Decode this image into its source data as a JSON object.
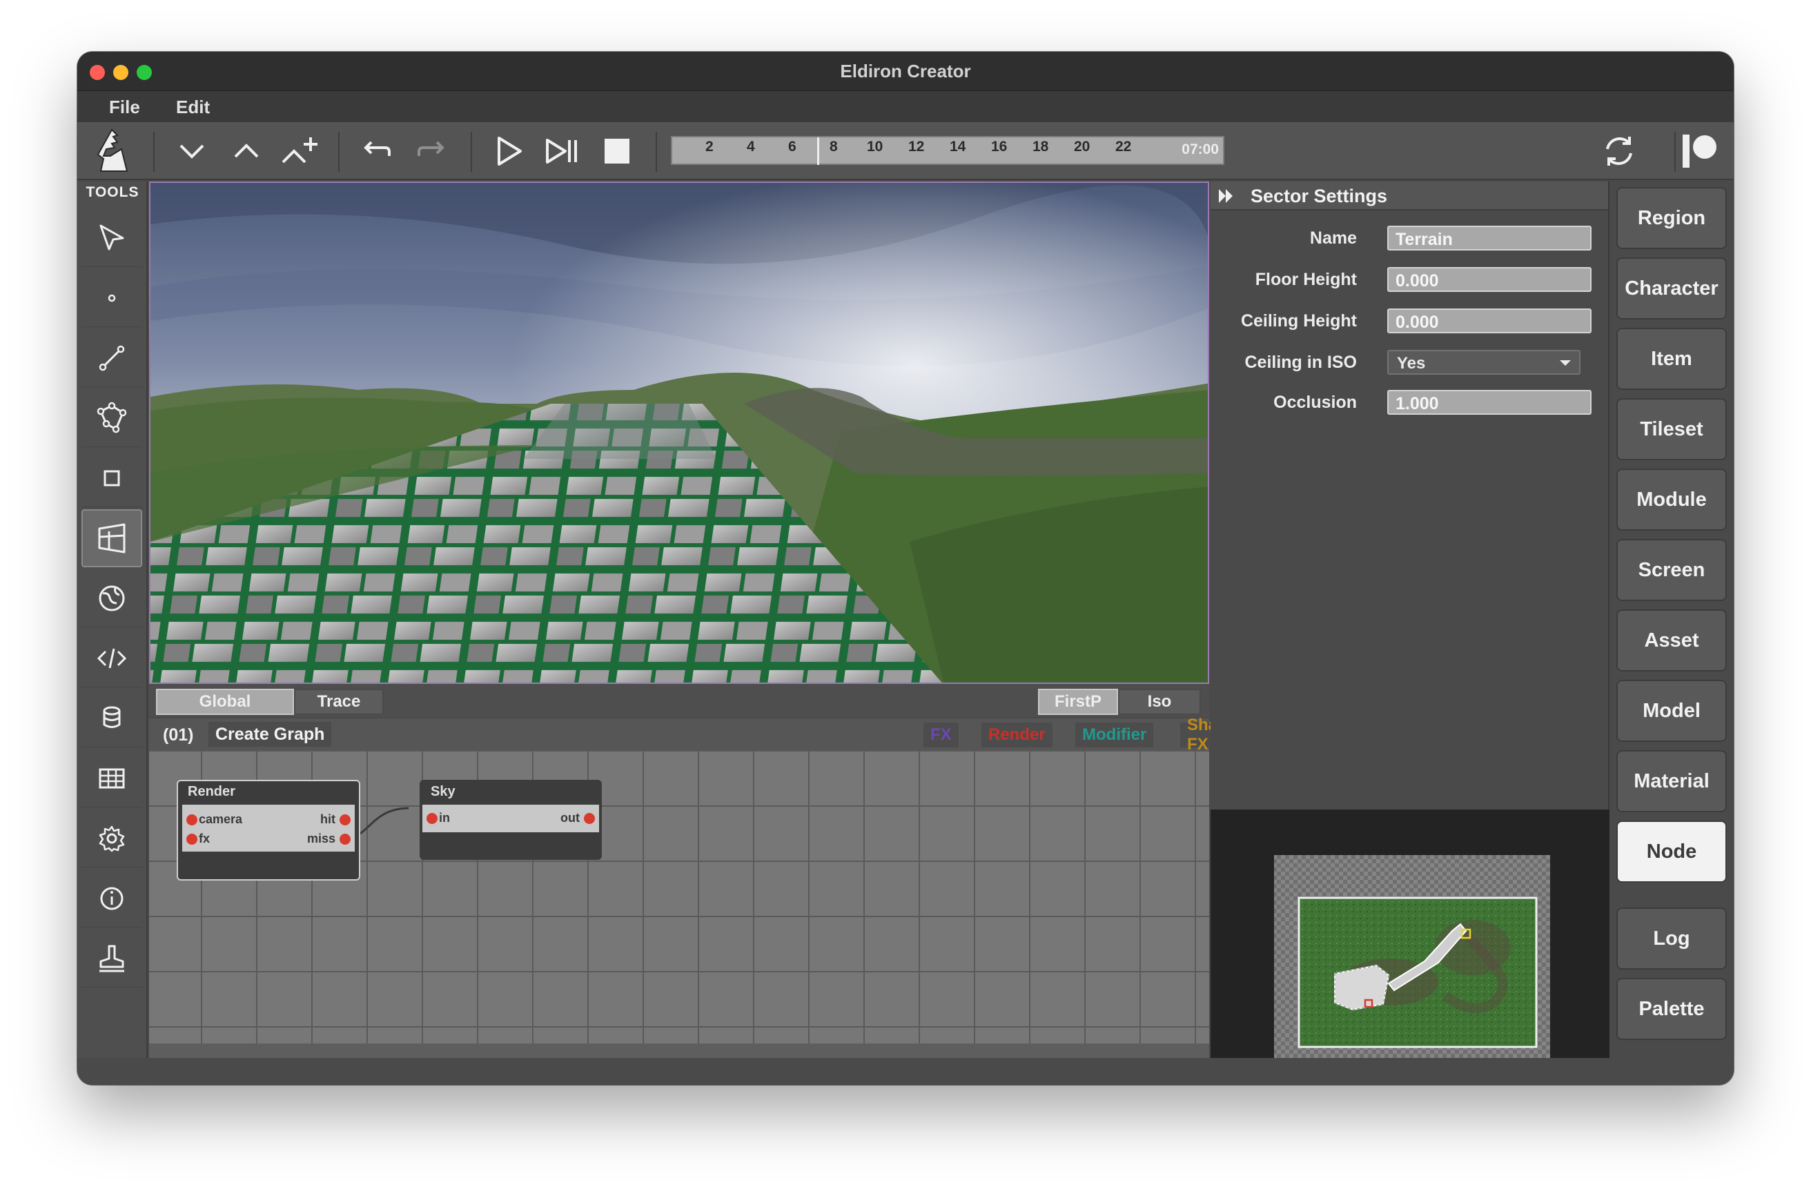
{
  "window": {
    "title": "Eldiron Creator"
  },
  "menu": [
    "File",
    "Edit"
  ],
  "toolbar": {
    "timeline": {
      "ticks": [
        "2",
        "4",
        "6",
        "8",
        "10",
        "12",
        "14",
        "16",
        "18",
        "20",
        "22"
      ],
      "time": "07:00"
    }
  },
  "tools": {
    "label": "TOOLS",
    "items": [
      "select-tool",
      "vertex-tool",
      "linedef-tool",
      "sector-tool",
      "rect-tool",
      "render-tool",
      "game-tool",
      "code-tool",
      "data-tool",
      "tileset-tool",
      "config-tool",
      "info-tool",
      "world-tool"
    ],
    "selected": "render-tool"
  },
  "viewport_bar": {
    "left_tabs": [
      "Global",
      "Trace"
    ],
    "right_tabs": [
      "FirstP",
      "Iso"
    ],
    "selected_left": "Global",
    "selected_right": "FirstP"
  },
  "graph": {
    "index": "(01)",
    "title": "Create Graph",
    "tags": [
      {
        "label": "FX",
        "color": "#6b47b5"
      },
      {
        "label": "Render",
        "color": "#c8302a"
      },
      {
        "label": "Modifier",
        "color": "#1f9a8e"
      },
      {
        "label": "Shape FX",
        "color": "#c08a18"
      }
    ],
    "nodes": [
      {
        "title": "Render",
        "inputs": [
          "camera",
          "fx"
        ],
        "outputs": [
          "hit",
          "miss"
        ]
      },
      {
        "title": "Sky",
        "inputs": [
          "in"
        ],
        "outputs": [
          "out"
        ]
      }
    ]
  },
  "sector_settings": {
    "header": "Sector Settings",
    "fields": [
      {
        "label": "Name",
        "value": "Terrain"
      },
      {
        "label": "Floor Height",
        "value": "0.000"
      },
      {
        "label": "Ceiling Height",
        "value": "0.000"
      },
      {
        "label": "Ceiling in ISO",
        "value": "Yes"
      },
      {
        "label": "Occlusion",
        "value": "1.000"
      }
    ]
  },
  "dock": {
    "buttons": [
      "Region",
      "Character",
      "Item",
      "Tileset",
      "Module",
      "Screen",
      "Asset",
      "Model",
      "Material",
      "Node"
    ],
    "selected": "Node",
    "bottom_buttons": [
      "Log",
      "Palette"
    ]
  },
  "colors": {
    "accent_selected": "#f2f2f2",
    "port": "#d83a2e",
    "viewport_border": "#9a7ab0"
  }
}
